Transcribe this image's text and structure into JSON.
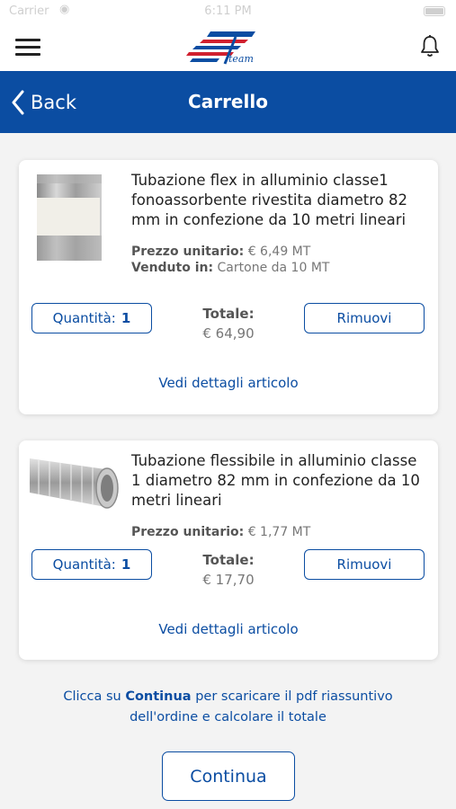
{
  "status_bar": {
    "carrier": "Carrier",
    "time": "6:11 PM"
  },
  "header": {
    "logo_text": "team"
  },
  "nav": {
    "back_label": "Back",
    "title": "Carrello"
  },
  "cart": {
    "items": [
      {
        "name": "Tubazione flex in alluminio classe1 fonoassorbente rivestita diametro 82 mm in confezione da 10 metri lineari",
        "unit_price_label": "Prezzo unitario:",
        "unit_price": "€ 6,49 MT",
        "sold_in_label": "Venduto in:",
        "sold_in": "Cartone da 10 MT",
        "quantity_label": "Quantità:",
        "quantity": "1",
        "total_label": "Totale:",
        "total": "€ 64,90",
        "remove_label": "Rimuovi",
        "details_label": "Vedi dettagli articolo"
      },
      {
        "name": "Tubazione flessibile in alluminio classe 1 diametro 82 mm in confezione da 10 metri lineari",
        "unit_price_label": "Prezzo unitario:",
        "unit_price": "€ 1,77 MT",
        "quantity_label": "Quantità:",
        "quantity": "1",
        "total_label": "Totale:",
        "total": "€ 17,70",
        "remove_label": "Rimuovi",
        "details_label": "Vedi dettagli articolo"
      }
    ]
  },
  "footer": {
    "note_prefix": "Clicca su",
    "note_bold": "Continua",
    "note_suffix": "per scaricare il pdf riassuntivo dell'ordine e calcolare il totale",
    "continue_label": "Continua"
  },
  "colors": {
    "accent": "#0b4da2",
    "logo_red": "#d0202f",
    "background": "#f3f3f3"
  },
  "icons": {
    "menu": "hamburger-menu-icon",
    "notifications": "bell-icon",
    "back": "chevron-left-icon"
  }
}
